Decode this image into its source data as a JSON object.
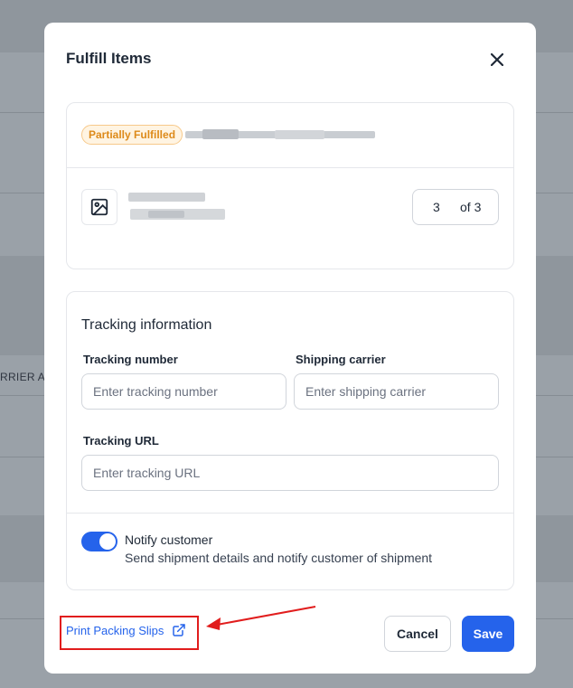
{
  "background": {
    "partial_column_text": "RRIER AN"
  },
  "modal": {
    "title": "Fulfill Items",
    "close_icon": "close-icon",
    "items_card": {
      "status_badge": "Partially Fulfilled",
      "status_color": "#dd8a1a",
      "item_thumbnail_icon": "image-icon",
      "quantity": "3",
      "quantity_total": "of 3"
    },
    "tracking": {
      "section_title": "Tracking information",
      "tracking_number_label": "Tracking number",
      "tracking_number_placeholder": "Enter tracking number",
      "shipping_carrier_label": "Shipping carrier",
      "shipping_carrier_placeholder": "Enter shipping carrier",
      "tracking_url_label": "Tracking URL",
      "tracking_url_placeholder": "Enter tracking URL",
      "notify_toggle_on": true,
      "notify_title": "Notify customer",
      "notify_description": "Send shipment details and notify customer of shipment"
    },
    "footer": {
      "print_packing_slips": "Print Packing Slips",
      "external_link_icon": "external-link-icon",
      "cancel_label": "Cancel",
      "save_label": "Save"
    },
    "accent_color": "#2563eb",
    "annotation_color": "#e11d1d"
  }
}
